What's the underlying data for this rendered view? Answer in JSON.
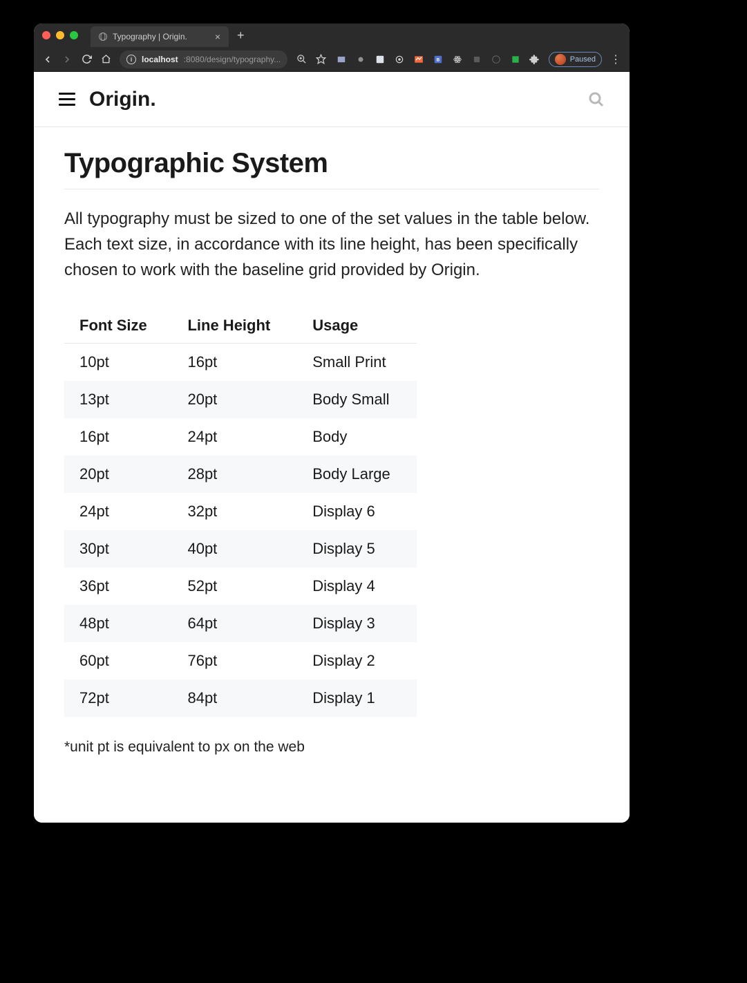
{
  "browser": {
    "tab_title": "Typography | Origin.",
    "url_host": "localhost",
    "url_port_path": ":8080/design/typography...",
    "paused_label": "Paused"
  },
  "app": {
    "brand": "Origin."
  },
  "page": {
    "title": "Typographic System",
    "intro": "All typography must be sized to one of the set values in the table below. Each text size, in accordance with its line height, has been specifically chosen to work with the baseline grid provided by Origin.",
    "footnote": "*unit pt is equivalent to px on the web"
  },
  "table": {
    "headers": {
      "font_size": "Font Size",
      "line_height": "Line Height",
      "usage": "Usage"
    },
    "rows": [
      {
        "font_size": "10pt",
        "line_height": "16pt",
        "usage": "Small Print"
      },
      {
        "font_size": "13pt",
        "line_height": "20pt",
        "usage": "Body Small"
      },
      {
        "font_size": "16pt",
        "line_height": "24pt",
        "usage": "Body"
      },
      {
        "font_size": "20pt",
        "line_height": "28pt",
        "usage": "Body Large"
      },
      {
        "font_size": "24pt",
        "line_height": "32pt",
        "usage": "Display 6"
      },
      {
        "font_size": "30pt",
        "line_height": "40pt",
        "usage": "Display 5"
      },
      {
        "font_size": "36pt",
        "line_height": "52pt",
        "usage": "Display 4"
      },
      {
        "font_size": "48pt",
        "line_height": "64pt",
        "usage": "Display 3"
      },
      {
        "font_size": "60pt",
        "line_height": "76pt",
        "usage": "Display 2"
      },
      {
        "font_size": "72pt",
        "line_height": "84pt",
        "usage": "Display 1"
      }
    ]
  }
}
